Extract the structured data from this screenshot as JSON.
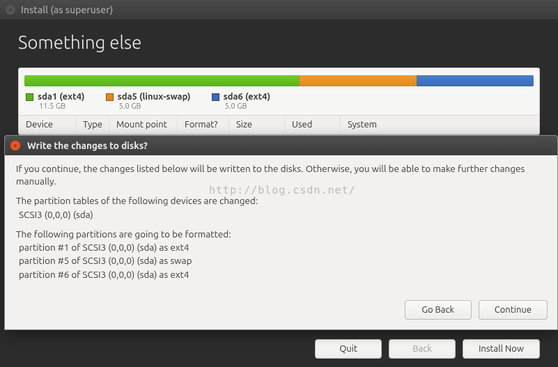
{
  "installer": {
    "window_title": "Install (as superuser)",
    "heading": "Something else",
    "partitions_bar": [
      {
        "color": "g",
        "width_pct": 54
      },
      {
        "color": "o",
        "width_pct": 23
      },
      {
        "color": "b",
        "width_pct": 23
      }
    ],
    "legend": [
      {
        "swatch": "g",
        "label": "sda1 (ext4)",
        "size": "11.5 GB"
      },
      {
        "swatch": "o",
        "label": "sda5 (linux-swap)",
        "size": "5.0 GB"
      },
      {
        "swatch": "b",
        "label": "sda6 (ext4)",
        "size": "5.0 GB"
      }
    ],
    "table_headers": [
      "Device",
      "Type",
      "Mount point",
      "Format?",
      "Size",
      "Used",
      "System"
    ],
    "buttons": {
      "quit": "Quit",
      "back": "Back",
      "install": "Install Now"
    }
  },
  "dialog": {
    "title": "Write the changes to disks?",
    "intro": "If you continue, the changes listed below will be written to the disks. Otherwise, you will be able to make further changes manually.",
    "section1_head": "The partition tables of the following devices are changed:",
    "section1_items": [
      "SCSI3 (0,0,0) (sda)"
    ],
    "section2_head": "The following partitions are going to be formatted:",
    "section2_items": [
      "partition #1 of SCSI3 (0,0,0) (sda) as ext4",
      "partition #5 of SCSI3 (0,0,0) (sda) as swap",
      "partition #6 of SCSI3 (0,0,0) (sda) as ext4"
    ],
    "buttons": {
      "go_back": "Go Back",
      "continue": "Continue"
    }
  },
  "watermark": "http://blog.csdn.net/"
}
